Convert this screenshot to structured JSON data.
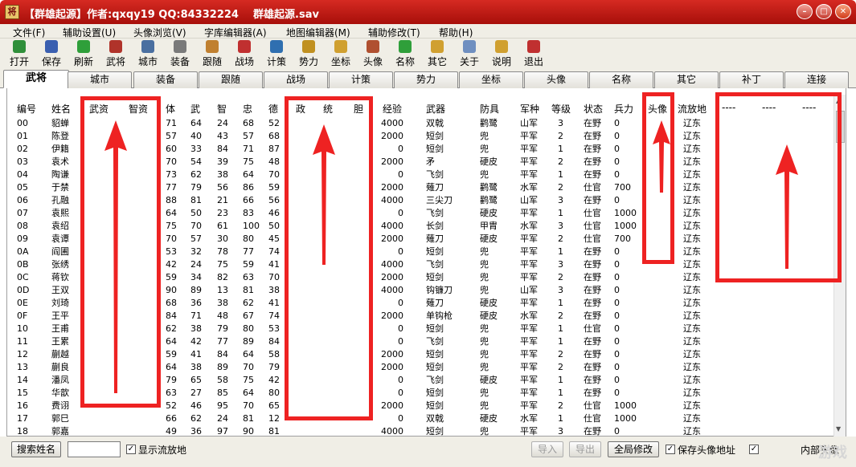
{
  "window": {
    "title": "【群雄起源】作者:qxqy19 QQ:84332224    群雄起源.sav",
    "controls": [
      "minimize",
      "maximize",
      "close"
    ]
  },
  "menu": [
    "文件(F)",
    "辅助设置(U)",
    "头像浏览(V)",
    "字库编辑器(A)",
    "地图编辑器(M)",
    "辅助修改(T)",
    "帮助(H)"
  ],
  "toolbar": [
    {
      "label": "打开",
      "icon": "open-icon",
      "color": "#2f8f3a"
    },
    {
      "label": "保存",
      "icon": "save-icon",
      "color": "#3a5fb0"
    },
    {
      "label": "刷新",
      "icon": "refresh-icon",
      "color": "#2f9f3a"
    },
    {
      "label": "武将",
      "icon": "general-icon",
      "color": "#b0332a"
    },
    {
      "label": "城市",
      "icon": "city-icon",
      "color": "#4a6fa0"
    },
    {
      "label": "装备",
      "icon": "equipment-icon",
      "color": "#7a7a7a"
    },
    {
      "label": "跟随",
      "icon": "follow-icon",
      "color": "#c08030"
    },
    {
      "label": "战场",
      "icon": "battlefield-icon",
      "color": "#c03030"
    },
    {
      "label": "计策",
      "icon": "strategy-icon",
      "color": "#2f6fb0"
    },
    {
      "label": "势力",
      "icon": "faction-icon",
      "color": "#c09020"
    },
    {
      "label": "坐标",
      "icon": "coordinate-icon",
      "color": "#d0a030"
    },
    {
      "label": "头像",
      "icon": "portrait-icon",
      "color": "#b05030"
    },
    {
      "label": "名称",
      "icon": "name-icon",
      "color": "#2f9f3a"
    },
    {
      "label": "其它",
      "icon": "other-icon",
      "color": "#d0a030"
    },
    {
      "label": "关于",
      "icon": "about-icon",
      "color": "#6f8fc0"
    },
    {
      "label": "说明",
      "icon": "help-icon",
      "color": "#d0a030"
    },
    {
      "label": "退出",
      "icon": "exit-icon",
      "color": "#c03030"
    }
  ],
  "tabs": [
    "武将",
    "城市",
    "装备",
    "跟随",
    "战场",
    "计策",
    "势力",
    "坐标",
    "头像",
    "名称",
    "其它",
    "补丁",
    "连接"
  ],
  "active_tab": "武将",
  "columns": [
    "编号",
    "姓名",
    "武资",
    "智资",
    "体",
    "武",
    "智",
    "忠",
    "德",
    "政",
    "统",
    "胆",
    "经验",
    "武器",
    "防具",
    "军种",
    "等级",
    "状态",
    "兵力",
    "头像",
    "流放地",
    "----",
    "----",
    "----"
  ],
  "rows": [
    [
      "00",
      "貂蝉",
      "71",
      "64",
      "24",
      "68",
      "52",
      "4000",
      "双戟",
      "鹳鹭",
      "山军",
      "3",
      "在野",
      "0",
      "辽东"
    ],
    [
      "01",
      "陈登",
      "57",
      "40",
      "43",
      "57",
      "68",
      "2000",
      "短剑",
      "兜",
      "平军",
      "2",
      "在野",
      "0",
      "辽东"
    ],
    [
      "02",
      "伊籍",
      "60",
      "33",
      "84",
      "71",
      "87",
      "0",
      "短剑",
      "兜",
      "平军",
      "1",
      "在野",
      "0",
      "辽东"
    ],
    [
      "03",
      "袁术",
      "70",
      "54",
      "39",
      "75",
      "48",
      "2000",
      "矛",
      "硬皮",
      "平军",
      "2",
      "在野",
      "0",
      "辽东"
    ],
    [
      "04",
      "陶谦",
      "73",
      "62",
      "38",
      "64",
      "70",
      "0",
      "飞剑",
      "兜",
      "平军",
      "1",
      "在野",
      "0",
      "辽东"
    ],
    [
      "05",
      "于禁",
      "77",
      "79",
      "56",
      "86",
      "59",
      "2000",
      "薙刀",
      "鹳鹭",
      "水军",
      "2",
      "仕官",
      "700",
      "辽东"
    ],
    [
      "06",
      "孔融",
      "88",
      "81",
      "21",
      "66",
      "56",
      "4000",
      "三尖刀",
      "鹳鹭",
      "山军",
      "3",
      "在野",
      "0",
      "辽东"
    ],
    [
      "07",
      "袁熙",
      "64",
      "50",
      "23",
      "83",
      "46",
      "0",
      "飞剑",
      "硬皮",
      "平军",
      "1",
      "仕官",
      "1000",
      "辽东"
    ],
    [
      "08",
      "袁绍",
      "75",
      "70",
      "61",
      "100",
      "50",
      "4000",
      "长剑",
      "甲胄",
      "水军",
      "3",
      "仕官",
      "1000",
      "辽东"
    ],
    [
      "09",
      "袁谭",
      "70",
      "57",
      "30",
      "80",
      "45",
      "2000",
      "薙刀",
      "硬皮",
      "平军",
      "2",
      "仕官",
      "700",
      "辽东"
    ],
    [
      "0A",
      "阎圃",
      "53",
      "32",
      "78",
      "77",
      "74",
      "0",
      "短剑",
      "兜",
      "平军",
      "1",
      "在野",
      "0",
      "辽东"
    ],
    [
      "0B",
      "张绣",
      "42",
      "24",
      "75",
      "59",
      "41",
      "4000",
      "飞剑",
      "兜",
      "平军",
      "3",
      "在野",
      "0",
      "辽东"
    ],
    [
      "0C",
      "蒋钦",
      "59",
      "34",
      "82",
      "63",
      "70",
      "2000",
      "短剑",
      "兜",
      "平军",
      "2",
      "在野",
      "0",
      "辽东"
    ],
    [
      "0D",
      "王双",
      "90",
      "89",
      "13",
      "81",
      "38",
      "4000",
      "钩镰刀",
      "兜",
      "山军",
      "3",
      "在野",
      "0",
      "辽东"
    ],
    [
      "0E",
      "刘琦",
      "68",
      "36",
      "38",
      "62",
      "41",
      "0",
      "薙刀",
      "硬皮",
      "平军",
      "1",
      "在野",
      "0",
      "辽东"
    ],
    [
      "0F",
      "王平",
      "84",
      "71",
      "48",
      "67",
      "74",
      "2000",
      "单钩枪",
      "硬皮",
      "水军",
      "2",
      "在野",
      "0",
      "辽东"
    ],
    [
      "10",
      "王甫",
      "62",
      "38",
      "79",
      "80",
      "53",
      "0",
      "短剑",
      "兜",
      "平军",
      "1",
      "仕官",
      "0",
      "辽东"
    ],
    [
      "11",
      "王累",
      "64",
      "42",
      "77",
      "89",
      "84",
      "0",
      "飞剑",
      "兜",
      "平军",
      "1",
      "在野",
      "0",
      "辽东"
    ],
    [
      "12",
      "蒯越",
      "59",
      "41",
      "84",
      "64",
      "58",
      "2000",
      "短剑",
      "兜",
      "平军",
      "2",
      "在野",
      "0",
      "辽东"
    ],
    [
      "13",
      "蒯良",
      "64",
      "38",
      "89",
      "70",
      "79",
      "2000",
      "短剑",
      "兜",
      "平军",
      "2",
      "在野",
      "0",
      "辽东"
    ],
    [
      "14",
      "潘凤",
      "79",
      "65",
      "58",
      "75",
      "42",
      "0",
      "飞剑",
      "硬皮",
      "平军",
      "1",
      "在野",
      "0",
      "辽东"
    ],
    [
      "15",
      "华歆",
      "63",
      "27",
      "85",
      "64",
      "80",
      "0",
      "短剑",
      "兜",
      "平军",
      "1",
      "在野",
      "0",
      "辽东"
    ],
    [
      "16",
      "费诩",
      "52",
      "46",
      "95",
      "70",
      "65",
      "2000",
      "短剑",
      "兜",
      "平军",
      "2",
      "仕官",
      "1000",
      "辽东"
    ],
    [
      "17",
      "郭巳",
      "66",
      "62",
      "24",
      "81",
      "12",
      "0",
      "双戟",
      "硬皮",
      "水军",
      "1",
      "仕官",
      "1000",
      "辽东"
    ],
    [
      "18",
      "郭嘉",
      "49",
      "36",
      "97",
      "90",
      "81",
      "4000",
      "短剑",
      "兜",
      "平军",
      "3",
      "在野",
      "0",
      "辽东"
    ]
  ],
  "bottom": {
    "search_button": "搜索姓名",
    "search_value": "",
    "show_exile_label": "显示流放地",
    "show_exile_checked": true,
    "import_button": "导入",
    "export_button": "导出",
    "global_modify_button": "全局修改",
    "save_avatar_label": "保存头像地址",
    "save_avatar_checked": true,
    "internal_avatar_label": "内部头像",
    "internal_avatar_checked": true
  },
  "watermark": "游戏"
}
